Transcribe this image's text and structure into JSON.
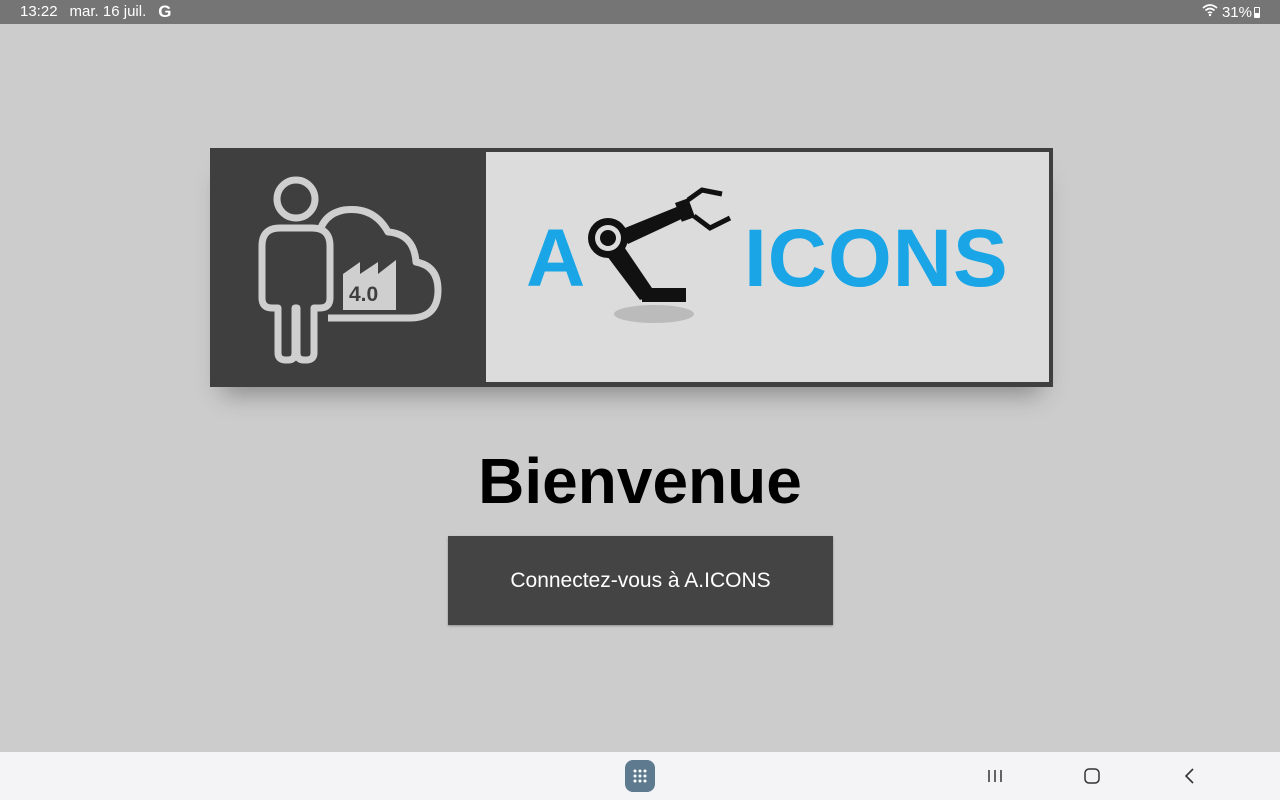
{
  "status_bar": {
    "time": "13:22",
    "date": "mar. 16 juil.",
    "google_icon_glyph": "G",
    "battery_text": "31%",
    "icons": [
      "google-icon",
      "wifi-icon",
      "battery-icon"
    ]
  },
  "banner": {
    "badge_text": "4.0",
    "logo_left": "A",
    "logo_right": "ICONS",
    "logo_color": "#1aa6e6",
    "icons": [
      "person-icon",
      "cloud-factory-icon",
      "robot-arm-icon"
    ]
  },
  "main": {
    "title": "Bienvenue",
    "connect_button_label": "Connectez-vous à A.ICONS"
  },
  "nav_bar": {
    "icons": [
      "apps-grid-icon",
      "recent-apps-icon",
      "home-icon",
      "back-icon"
    ]
  },
  "colors": {
    "background": "#cccccc",
    "status_bar": "#757575",
    "banner_dark": "#3f3f3f",
    "button": "#444444",
    "accent": "#1aa6e6"
  }
}
